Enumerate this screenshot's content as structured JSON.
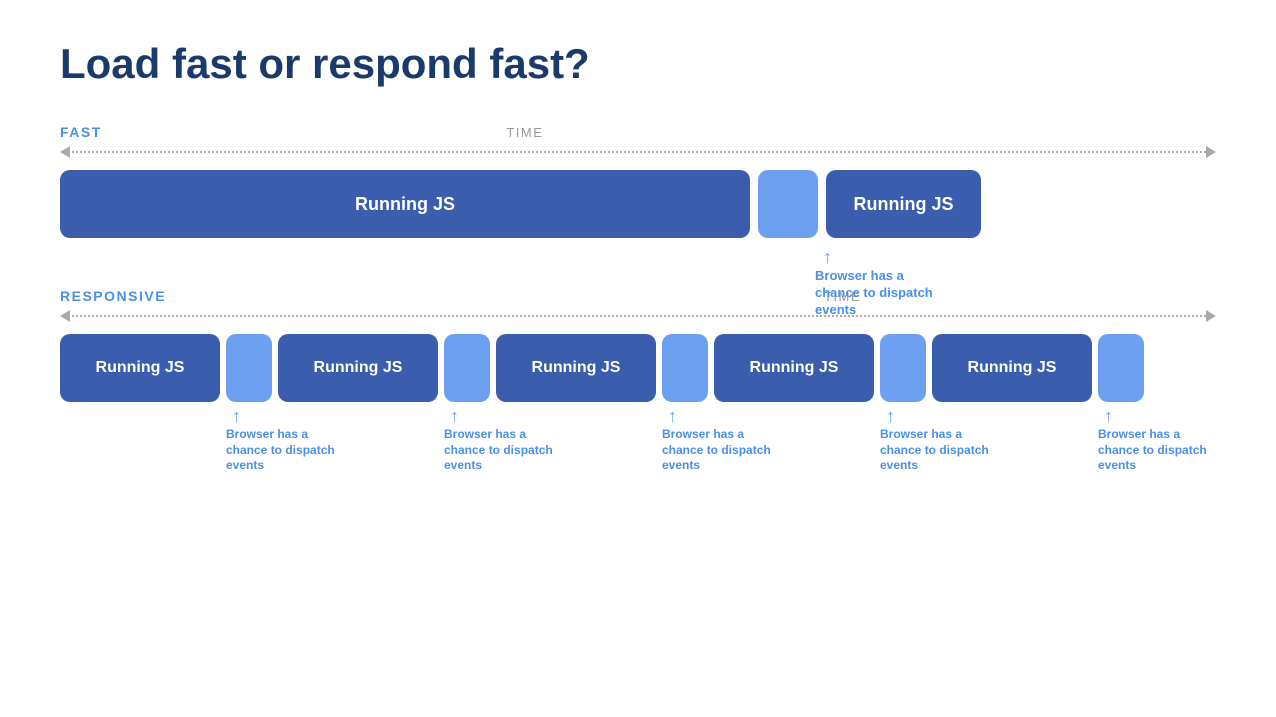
{
  "title": "Load fast or respond fast?",
  "fast_section": {
    "label": "FAST",
    "time_label": "TIME",
    "blocks": [
      {
        "type": "large",
        "text": "Running JS"
      },
      {
        "type": "small",
        "text": ""
      },
      {
        "type": "medium",
        "text": "Running JS"
      }
    ],
    "annotation": "Browser has a chance to dispatch events"
  },
  "responsive_section": {
    "label": "RESPONSIVE",
    "time_label": "TIME",
    "blocks": [
      {
        "type": "resp",
        "text": "Running JS"
      },
      {
        "type": "small",
        "text": ""
      },
      {
        "type": "resp",
        "text": "Running JS"
      },
      {
        "type": "small",
        "text": ""
      },
      {
        "type": "resp",
        "text": "Running JS"
      },
      {
        "type": "small",
        "text": ""
      },
      {
        "type": "resp",
        "text": "Running JS"
      },
      {
        "type": "small",
        "text": ""
      },
      {
        "type": "resp",
        "text": "Running JS"
      },
      {
        "type": "small",
        "text": ""
      }
    ],
    "annotation": "Browser has a chance to dispatch events",
    "annotation_count": 5
  }
}
